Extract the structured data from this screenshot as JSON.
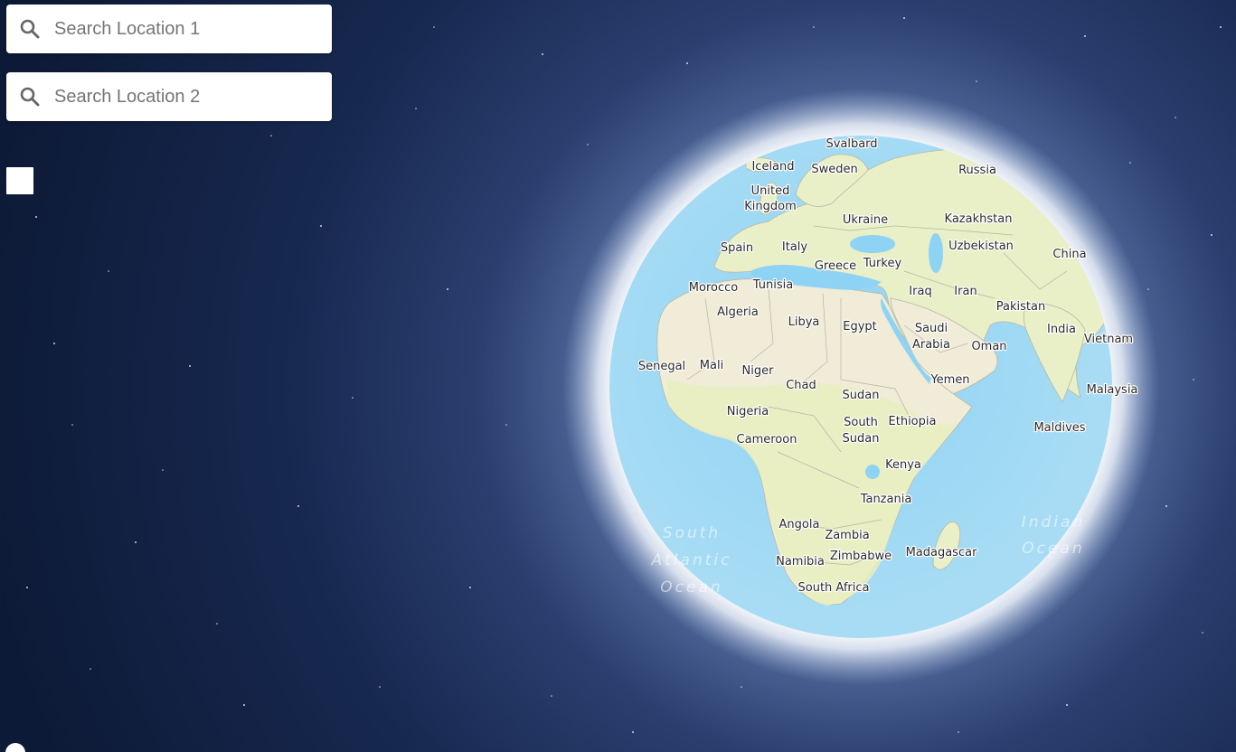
{
  "search": {
    "location1": {
      "placeholder": "Search Location 1",
      "value": ""
    },
    "location2": {
      "placeholder": "Search Location 2",
      "value": ""
    },
    "icon": "search-icon"
  },
  "colors": {
    "space_dark": "#0d1a37",
    "ocean": "#8fd3f4",
    "land": "#f0ecd7",
    "land_green": "#e8efc2",
    "glow": "#ffffff"
  },
  "map": {
    "countries": [
      "Svalbard",
      "Iceland",
      "Sweden",
      "Russia",
      "United",
      "Kingdom",
      "Ukraine",
      "Kazakhstan",
      "Spain",
      "Italy",
      "Uzbekistan",
      "China",
      "Greece",
      "Turkey",
      "Morocco",
      "Tunisia",
      "Iraq",
      "Iran",
      "Pakistan",
      "Algeria",
      "Libya",
      "Egypt",
      "Saudi",
      "Arabia",
      "Oman",
      "India",
      "Vietnam",
      "Senegal",
      "Mali",
      "Niger",
      "Yemen",
      "Malaysia",
      "Chad",
      "Sudan",
      "Nigeria",
      "South",
      "Sudan",
      "Ethiopia",
      "Maldives",
      "Cameroon",
      "Kenya",
      "Tanzania",
      "Angola",
      "Zambia",
      "Madagascar",
      "Namibia",
      "Zimbabwe",
      "South Africa"
    ],
    "oceans": [
      "South",
      "Atlantic",
      "Ocean",
      "Indian",
      "Ocean"
    ]
  }
}
